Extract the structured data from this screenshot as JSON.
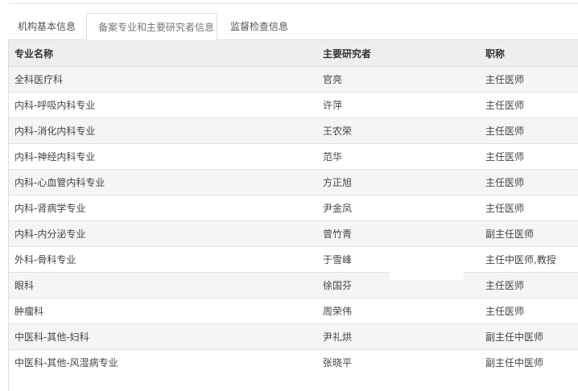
{
  "tabs": [
    {
      "label": "机构基本信息",
      "active": false
    },
    {
      "label": "备案专业和主要研究者信息",
      "active": true
    },
    {
      "label": "监督检查信息",
      "active": false
    }
  ],
  "table": {
    "headers": [
      "专业名称",
      "主要研究者",
      "职称"
    ],
    "rows": [
      [
        "全科医疗科",
        "官亮",
        "主任医师"
      ],
      [
        "内科-呼吸内科专业",
        "许萍",
        "主任医师"
      ],
      [
        "内科-消化内科专业",
        "王农荣",
        "主任医师"
      ],
      [
        "内科-神经内科专业",
        "范华",
        "主任医师"
      ],
      [
        "内科-心血管内科专业",
        "方正旭",
        "主任医师"
      ],
      [
        "内科-肾病学专业",
        "尹金凤",
        "主任医师"
      ],
      [
        "内科-内分泌专业",
        "曾竹青",
        "副主任医师"
      ],
      [
        "外科-骨科专业",
        "于雪峰",
        "主任中医师,教授"
      ],
      [
        "眼科",
        "徐国芬",
        "主任医师"
      ],
      [
        "肿瘤科",
        "周荣伟",
        "主任医师"
      ],
      [
        "中医科-其他-妇科",
        "尹礼烘",
        "副主任中医师"
      ],
      [
        "中医科-其他-风湿病专业",
        "张晓平",
        "副主任中医师"
      ]
    ]
  },
  "colors": {
    "header_bg": "#eeeeee",
    "stripe_bg": "#f5f5f5",
    "border": "#dddddd"
  }
}
